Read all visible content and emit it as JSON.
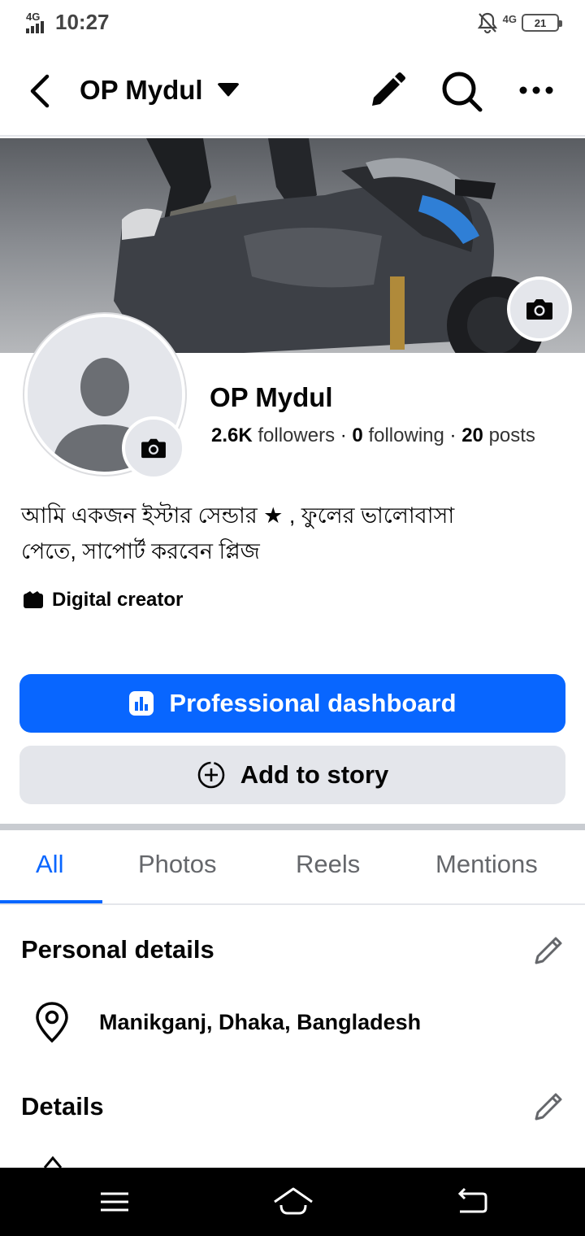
{
  "status_bar": {
    "network_left": "4G",
    "time": "10:27",
    "network_right": "4G",
    "battery": "21"
  },
  "header": {
    "title": "OP Mydul",
    "icons": [
      "back-icon",
      "caret-down-icon",
      "pencil-icon",
      "search-icon",
      "more-icon"
    ]
  },
  "profile": {
    "name": "OP Mydul",
    "followers_count": "2.6K",
    "followers_label": "followers",
    "following_count": "0",
    "following_label": "following",
    "posts_count": "20",
    "posts_label": "posts",
    "bio_line1": "আমি একজন ইস্টার সেন্ডার ★ , ফুলের ভালোবাসা",
    "bio_line2": "পেতে, সাপোর্ট করবেন প্লিজ",
    "category": "Digital creator"
  },
  "buttons": {
    "primary": "Professional dashboard",
    "secondary": "Add to story"
  },
  "tabs": [
    {
      "label": "All",
      "active": true
    },
    {
      "label": "Photos",
      "active": false
    },
    {
      "label": "Reels",
      "active": false
    },
    {
      "label": "Mentions",
      "active": false
    }
  ],
  "personal_details": {
    "title": "Personal details",
    "location": "Manikganj, Dhaka, Bangladesh"
  },
  "details": {
    "title": "Details"
  },
  "colors": {
    "accent": "#0866ff",
    "secondary_button": "#e4e6eb",
    "muted_text": "#65676b"
  }
}
